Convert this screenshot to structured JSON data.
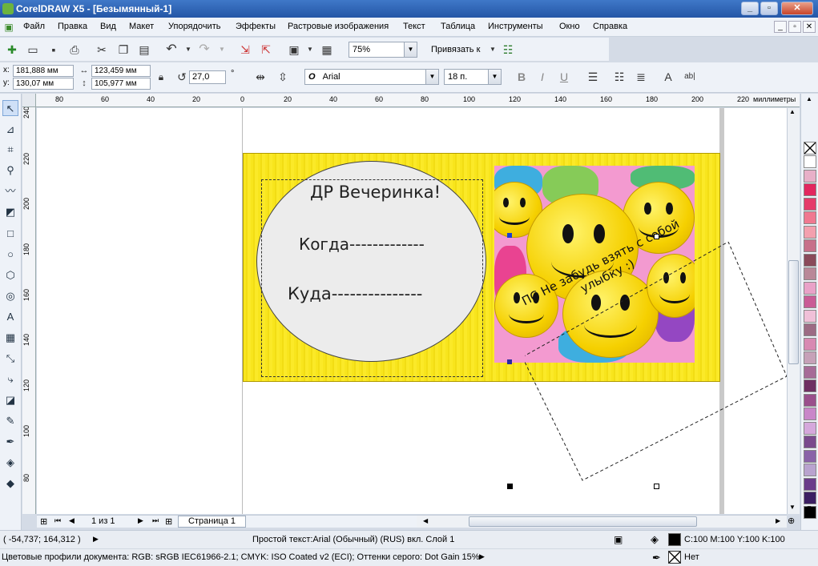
{
  "window": {
    "title": "CorelDRAW X5 - [Безымянный-1]",
    "minimize": "_",
    "restore": "▫",
    "close": "✕"
  },
  "menu": [
    "Файл",
    "Правка",
    "Вид",
    "Макет",
    "Упорядочить",
    "Эффекты",
    "Растровые изображения",
    "Текст",
    "Таблица",
    "Инструменты",
    "Окно",
    "Справка"
  ],
  "toolbar": {
    "zoom": "75%",
    "snap_label": "Привязать к"
  },
  "props": {
    "x_label": "x:",
    "x": "181,888 мм",
    "y_label": "y:",
    "y": "130,07 мм",
    "w": "123,459 мм",
    "h": "105,977 мм",
    "angle": "27,0",
    "degree": "°",
    "font": "Arial",
    "size": "18 п.",
    "bold": "B",
    "italic": "I",
    "underline": "U"
  },
  "ruler": {
    "h_ticks": [
      "80",
      "60",
      "40",
      "20",
      "0",
      "20",
      "40",
      "60",
      "80",
      "100",
      "120",
      "140",
      "160",
      "180",
      "200",
      "220"
    ],
    "unit": "миллиметры",
    "v_ticks": [
      "240",
      "220",
      "200",
      "180",
      "160",
      "140",
      "120",
      "100",
      "80"
    ]
  },
  "card": {
    "line1": "ДР Вечеринка!",
    "line2": "Когда-------------",
    "line3": "Куда---------------",
    "rotated_text": "ПС Не забудь взять с собой улыбку :)"
  },
  "pagenav": {
    "counter": "1 из 1",
    "page_tab": "Страница 1"
  },
  "palette_colors": [
    "#ffffff",
    "#e8b0c8",
    "#e2275f",
    "#e53a6a",
    "#f07890",
    "#f3a0ae",
    "#c7708a",
    "#8a4a5a",
    "#b98898",
    "#e9a2c8",
    "#c95c96",
    "#f0c0d8",
    "#9c6b84",
    "#d889b2",
    "#c6a1b8",
    "#a66b97",
    "#6f2f63",
    "#9a4f8c",
    "#c986c9",
    "#d5a8dc",
    "#7a4a8d",
    "#8a63a8",
    "#b9a3cf",
    "#6a3c8a",
    "#3c1f63",
    "#000000"
  ],
  "status": {
    "coords": "( -54,737; 164,312 )",
    "object_info": "Простой текст:Arial (Обычный) (RUS) вкл. Слой 1",
    "fill": "C:100 M:100 Y:100 K:100",
    "outline": "Нет",
    "profiles": "Цветовые профили документа: RGB: sRGB IEC61966-2.1; CMYK: ISO Coated v2 (ECI); Оттенки серого: Dot Gain 15%"
  }
}
